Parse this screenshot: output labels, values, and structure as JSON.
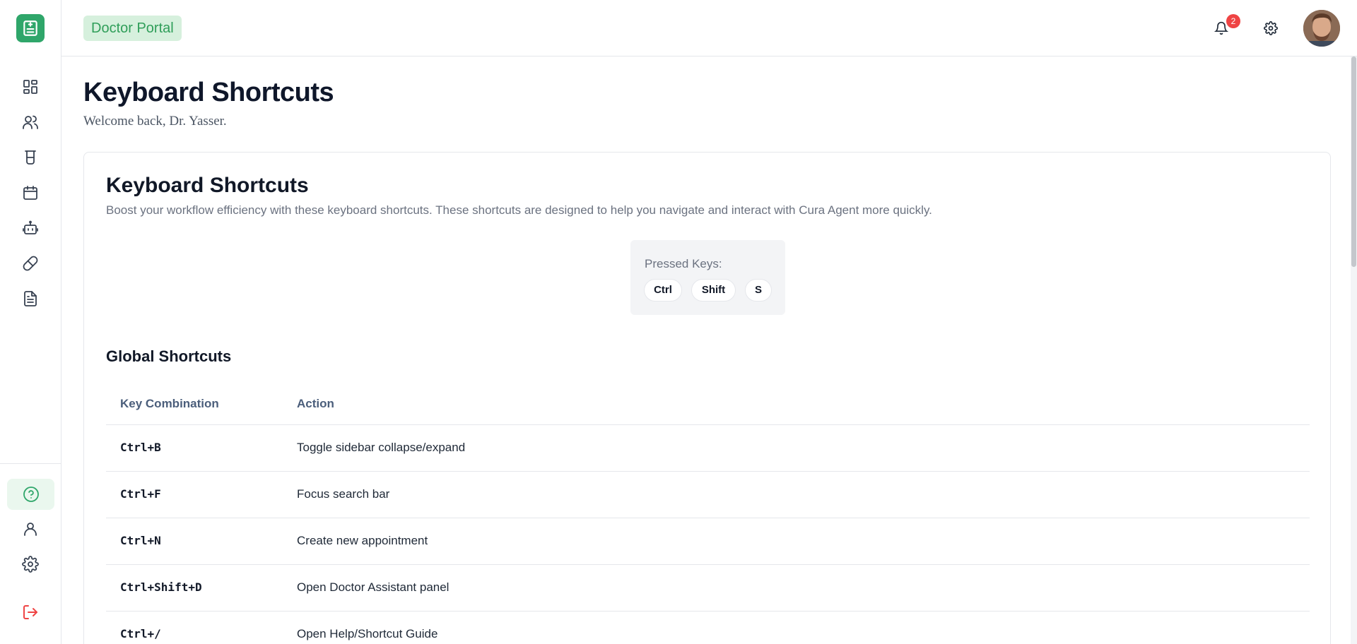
{
  "header": {
    "portal_label": "Doctor Portal",
    "notification_count": "2"
  },
  "sidebar": {
    "items": [
      {
        "name": "dashboard",
        "icon": "dashboard-grid-icon"
      },
      {
        "name": "patients",
        "icon": "users-icon"
      },
      {
        "name": "lab",
        "icon": "beaker-icon"
      },
      {
        "name": "calendar",
        "icon": "calendar-icon"
      },
      {
        "name": "assistant",
        "icon": "robot-icon"
      },
      {
        "name": "prescriptions",
        "icon": "pill-icon"
      },
      {
        "name": "documents",
        "icon": "document-icon"
      }
    ],
    "bottom_items": [
      {
        "name": "help",
        "icon": "help-circle-icon"
      },
      {
        "name": "profile",
        "icon": "user-icon"
      },
      {
        "name": "settings",
        "icon": "gear-icon"
      },
      {
        "name": "logout",
        "icon": "logout-icon"
      }
    ],
    "accent_color": "#2fa66a",
    "logout_color": "#ef4444"
  },
  "page": {
    "title": "Keyboard Shortcuts",
    "subtitle": "Welcome back, Dr. Yasser."
  },
  "card": {
    "title": "Keyboard Shortcuts",
    "description": "Boost your workflow efficiency with these keyboard shortcuts. These shortcuts are designed to help you navigate and interact with Cura Agent more quickly.",
    "pressed_label": "Pressed Keys:",
    "pressed_keys": [
      "Ctrl",
      "Shift",
      "S"
    ]
  },
  "global_shortcuts": {
    "title": "Global Shortcuts",
    "columns": [
      "Key Combination",
      "Action"
    ],
    "rows": [
      {
        "keys": "Ctrl+B",
        "action": "Toggle sidebar collapse/expand"
      },
      {
        "keys": "Ctrl+F",
        "action": "Focus search bar"
      },
      {
        "keys": "Ctrl+N",
        "action": "Create new appointment"
      },
      {
        "keys": "Ctrl+Shift+D",
        "action": "Open Doctor Assistant panel"
      },
      {
        "keys": "Ctrl+/",
        "action": "Open Help/Shortcut Guide"
      }
    ]
  }
}
